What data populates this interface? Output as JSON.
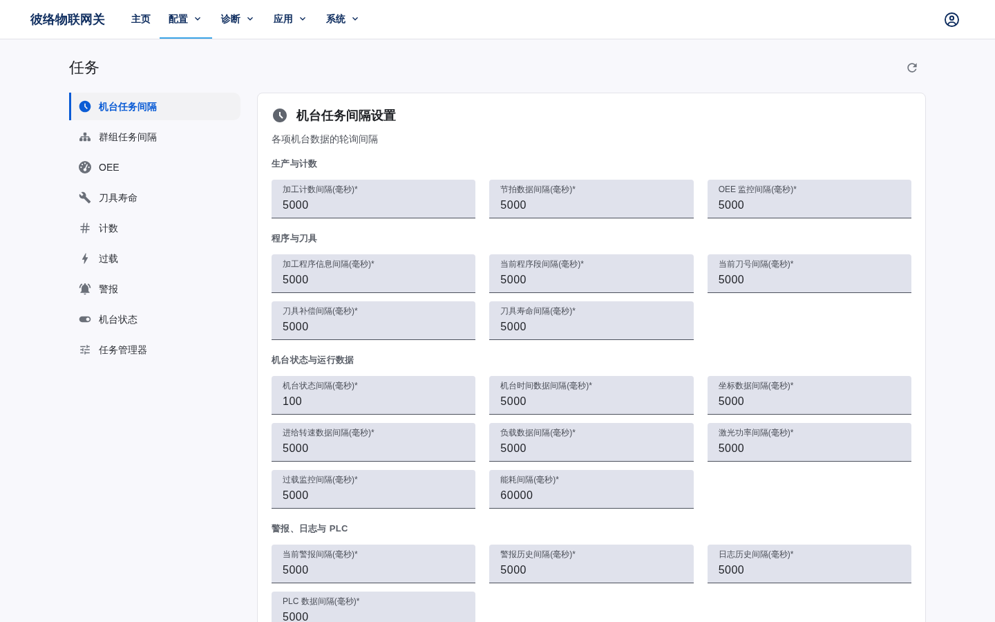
{
  "header": {
    "brand": "彼络物联网关",
    "nav": [
      {
        "label": "主页",
        "selected": false,
        "dropdown": false
      },
      {
        "label": "配置",
        "selected": true,
        "dropdown": true
      },
      {
        "label": "诊断",
        "selected": false,
        "dropdown": true
      },
      {
        "label": "应用",
        "selected": false,
        "dropdown": true
      },
      {
        "label": "系统",
        "selected": false,
        "dropdown": true
      }
    ]
  },
  "page": {
    "title": "任务"
  },
  "sidebar": {
    "items": [
      {
        "label": "机台任务间隔",
        "selected": true
      },
      {
        "label": "群组任务间隔",
        "selected": false
      },
      {
        "label": "OEE",
        "selected": false
      },
      {
        "label": "刀具寿命",
        "selected": false
      },
      {
        "label": "计数",
        "selected": false
      },
      {
        "label": "过载",
        "selected": false
      },
      {
        "label": "警报",
        "selected": false
      },
      {
        "label": "机台状态",
        "selected": false
      },
      {
        "label": "任务管理器",
        "selected": false
      }
    ]
  },
  "panel": {
    "title": "机台任务间隔设置",
    "subtitle": "各项机台数据的轮询间隔",
    "sections": [
      {
        "title": "生产与计数",
        "fields": [
          {
            "label": "加工计数间隔(毫秒)*",
            "value": "5000"
          },
          {
            "label": "节拍数据间隔(毫秒)*",
            "value": "5000"
          },
          {
            "label": "OEE 监控间隔(毫秒)*",
            "value": "5000"
          }
        ]
      },
      {
        "title": "程序与刀具",
        "fields": [
          {
            "label": "加工程序信息间隔(毫秒)*",
            "value": "5000"
          },
          {
            "label": "当前程序段间隔(毫秒)*",
            "value": "5000"
          },
          {
            "label": "当前刀号间隔(毫秒)*",
            "value": "5000"
          },
          {
            "label": "刀具补偿间隔(毫秒)*",
            "value": "5000"
          },
          {
            "label": "刀具寿命间隔(毫秒)*",
            "value": "5000"
          }
        ]
      },
      {
        "title": "机台状态与运行数据",
        "fields": [
          {
            "label": "机台状态间隔(毫秒)*",
            "value": "100"
          },
          {
            "label": "机台时间数据间隔(毫秒)*",
            "value": "5000"
          },
          {
            "label": "坐标数据间隔(毫秒)*",
            "value": "5000"
          },
          {
            "label": "进给转速数据间隔(毫秒)*",
            "value": "5000"
          },
          {
            "label": "负载数据间隔(毫秒)*",
            "value": "5000"
          },
          {
            "label": "激光功率间隔(毫秒)*",
            "value": "5000"
          },
          {
            "label": "过载监控间隔(毫秒)*",
            "value": "5000"
          },
          {
            "label": "能耗间隔(毫秒)*",
            "value": "60000"
          }
        ]
      },
      {
        "title": "警报、日志与 PLC",
        "fields": [
          {
            "label": "当前警报间隔(毫秒)*",
            "value": "5000"
          },
          {
            "label": "警报历史间隔(毫秒)*",
            "value": "5000"
          },
          {
            "label": "日志历史间隔(毫秒)*",
            "value": "5000"
          },
          {
            "label": "PLC 数据间隔(毫秒)*",
            "value": "5000"
          }
        ]
      }
    ]
  }
}
